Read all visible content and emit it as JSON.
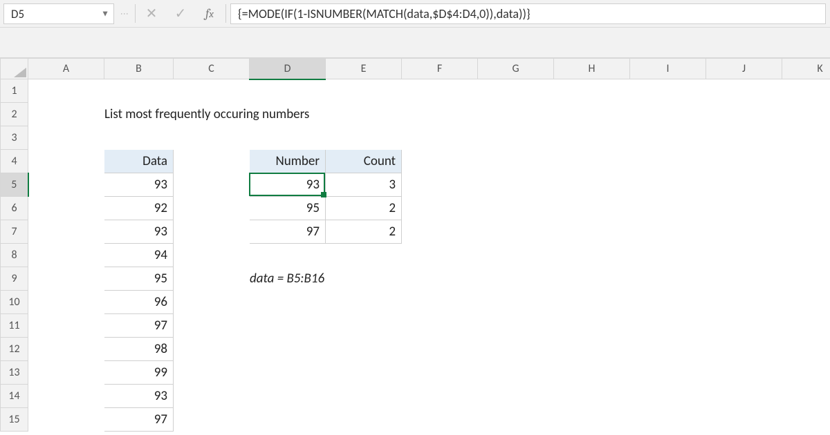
{
  "namebox": {
    "value": "D5"
  },
  "formula": "{=MODE(IF(1-ISNUMBER(MATCH(data,$D$4:D4,0)),data))}",
  "columns": [
    "A",
    "B",
    "C",
    "D",
    "E",
    "F",
    "G",
    "H",
    "I",
    "J",
    "K"
  ],
  "rows": [
    "1",
    "2",
    "3",
    "4",
    "5",
    "6",
    "7",
    "8",
    "9",
    "10",
    "11",
    "12",
    "13",
    "14",
    "15"
  ],
  "title": "List most frequently occuring numbers",
  "headers": {
    "data": "Data",
    "number": "Number",
    "count": "Count"
  },
  "data_values": [
    93,
    92,
    93,
    94,
    95,
    96,
    97,
    98,
    99,
    93,
    97
  ],
  "results": [
    {
      "number": 93,
      "count": 3
    },
    {
      "number": 95,
      "count": 2
    },
    {
      "number": 97,
      "count": 2
    }
  ],
  "note": "data = B5:B16",
  "selection": {
    "cell": "D5",
    "colIndex": 3,
    "rowIndex": 4
  }
}
